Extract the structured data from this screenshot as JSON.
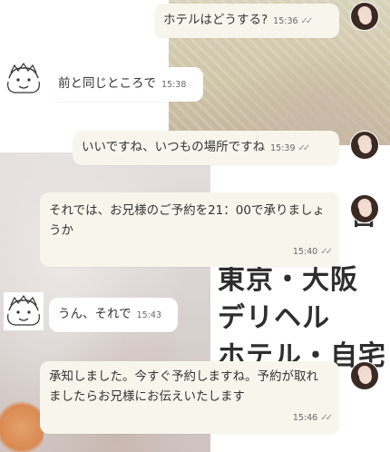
{
  "ad": {
    "line1": "東京・大阪",
    "line2": "デリヘル",
    "line3": "ホテル・自宅",
    "fragment": "習"
  },
  "messages": [
    {
      "text": "ホテルはどうする?",
      "time": "15:36",
      "outgoing": true
    },
    {
      "text": "前と同じところで",
      "time": "15:38",
      "outgoing": false
    },
    {
      "text": "いいですね、いつもの場所ですね",
      "time": "15:39",
      "outgoing": true
    },
    {
      "text": "それでは、お兄様のご予約を21：00で承りましょうか",
      "time": "15:40",
      "outgoing": true
    },
    {
      "text": "うん、それで",
      "time": "15:43",
      "outgoing": false
    },
    {
      "text": "承知しました。今すぐ予約しますね。予約が取れましたらお兄様にお伝えいたします",
      "time": "15:46",
      "outgoing": true
    }
  ],
  "icons": {
    "read_receipt": "double-check-icon",
    "customer_avatar": "cartoon-face-icon",
    "agent_avatar": "profile-photo-avatar"
  },
  "colors": {
    "outgoing_bubble": "#f8f6ec",
    "incoming_bubble": "#ffffff",
    "ad_text": "#2e2e2e"
  }
}
